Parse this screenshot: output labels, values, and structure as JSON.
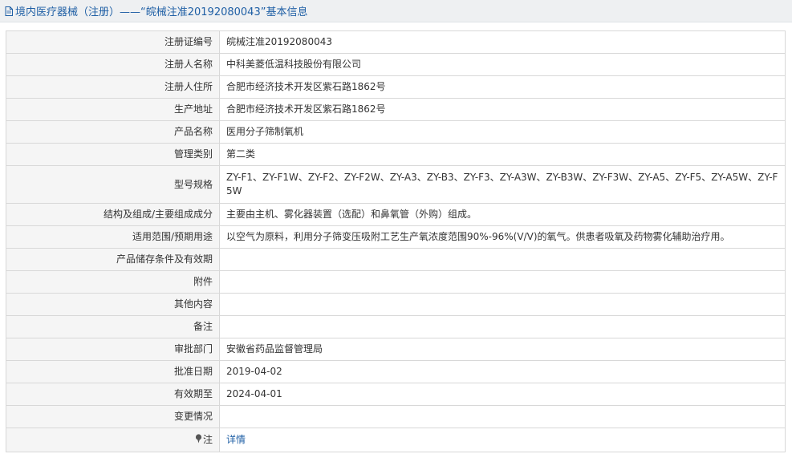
{
  "header": {
    "title": "境内医疗器械（注册）——“皖械注准20192080043”基本信息"
  },
  "rows": [
    {
      "label": "注册证编号",
      "value": "皖械注准20192080043"
    },
    {
      "label": "注册人名称",
      "value": "中科美菱低温科技股份有限公司"
    },
    {
      "label": "注册人住所",
      "value": "合肥市经济技术开发区紫石路1862号"
    },
    {
      "label": "生产地址",
      "value": "合肥市经济技术开发区紫石路1862号"
    },
    {
      "label": "产品名称",
      "value": "医用分子筛制氧机"
    },
    {
      "label": "管理类别",
      "value": "第二类"
    },
    {
      "label": "型号规格",
      "value": "ZY-F1、ZY-F1W、ZY-F2、ZY-F2W、ZY-A3、ZY-B3、ZY-F3、ZY-A3W、ZY-B3W、ZY-F3W、ZY-A5、ZY-F5、ZY-A5W、ZY-F5W"
    },
    {
      "label": "结构及组成/主要组成成分",
      "value": "主要由主机、雾化器装置（选配）和鼻氧管（外购）组成。"
    },
    {
      "label": "适用范围/预期用途",
      "value": "以空气为原料，利用分子筛变压吸附工艺生产氧浓度范围90%-96%(V/V)的氧气。供患者吸氧及药物雾化辅助治疗用。"
    },
    {
      "label": "产品储存条件及有效期",
      "value": ""
    },
    {
      "label": "附件",
      "value": ""
    },
    {
      "label": "其他内容",
      "value": ""
    },
    {
      "label": "备注",
      "value": ""
    },
    {
      "label": "审批部门",
      "value": "安徽省药品监督管理局"
    },
    {
      "label": "批准日期",
      "value": "2019-04-02"
    },
    {
      "label": "有效期至",
      "value": "2024-04-01"
    },
    {
      "label": "变更情况",
      "value": ""
    },
    {
      "label": "注",
      "value": "详情"
    }
  ],
  "icons": {
    "title": "document-icon",
    "note": "pin-icon"
  },
  "colors": {
    "link": "#1f5fa5",
    "label_bg": "#f5f5f5",
    "border": "#d8d8d8",
    "header_bg": "#eef0f2"
  }
}
